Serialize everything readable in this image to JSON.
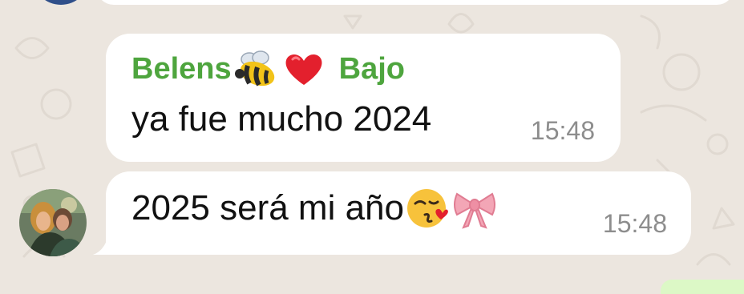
{
  "chat": {
    "messages": [
      {
        "sender_name": "Belens",
        "sender_suffix": "Bajo",
        "sender_emojis": [
          "bee-emoji",
          "red-heart-emoji"
        ],
        "text": "ya fue mucho 2024",
        "time": "15:48"
      },
      {
        "text": "2025 será mi año",
        "trailing_emojis": [
          "kissing-face-emoji",
          "ribbon-emoji"
        ],
        "time": "15:48"
      }
    ]
  },
  "colors": {
    "sender_name": "#4ea53e",
    "bubble": "#ffffff",
    "background": "#ece6df",
    "timestamp": "#8d8d8d"
  }
}
